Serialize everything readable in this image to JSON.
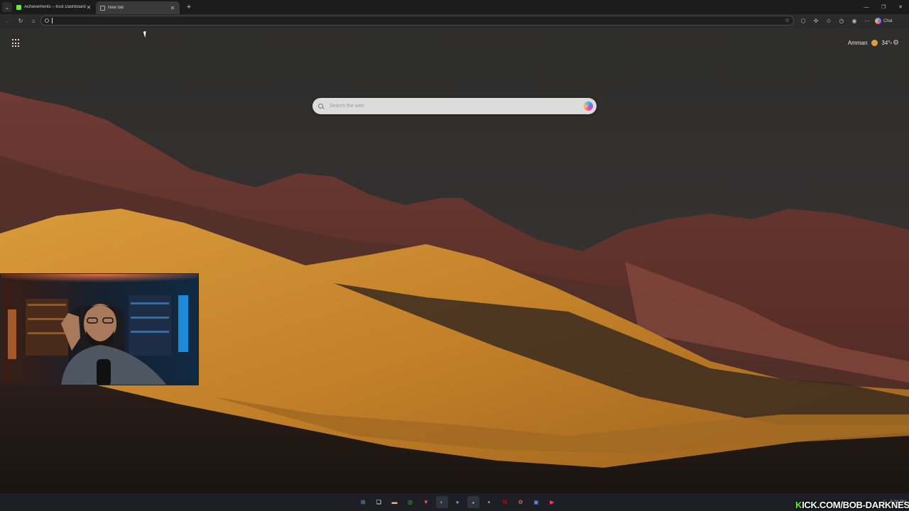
{
  "tabs": [
    {
      "title": "Achievements – Kick Dashboard",
      "favicon": "kick-icon",
      "active": false
    },
    {
      "title": "New tab",
      "favicon": "newtab-icon",
      "active": true
    }
  ],
  "toolbar": {
    "address_value": "",
    "chat_label": "Chat"
  },
  "newtab": {
    "search_placeholder": "Search the web",
    "weather": {
      "city": "Amman",
      "temp": "34°",
      "unit": "c",
      "icon": "sun-icon"
    }
  },
  "taskbar": {
    "apps": [
      "windows-start-icon",
      "task-view-icon",
      "file-explorer-icon",
      "chrome-icon",
      "brave-icon",
      "edge-icon",
      "discord-icon",
      "steam-icon",
      "obs-icon",
      "netflix-icon",
      "settings-app-icon",
      "teams-icon",
      "media-player-icon"
    ],
    "clock": "5:24 PM"
  },
  "overlay_banner": {
    "prefix": "K",
    "text": "ICK.COM/BOB-DARKNESS"
  },
  "colors": {
    "kick_green": "#53fc18",
    "dune_gold": "#c98a2c",
    "mountain_red": "#7a3a32",
    "sky": "#2e2e2e"
  }
}
